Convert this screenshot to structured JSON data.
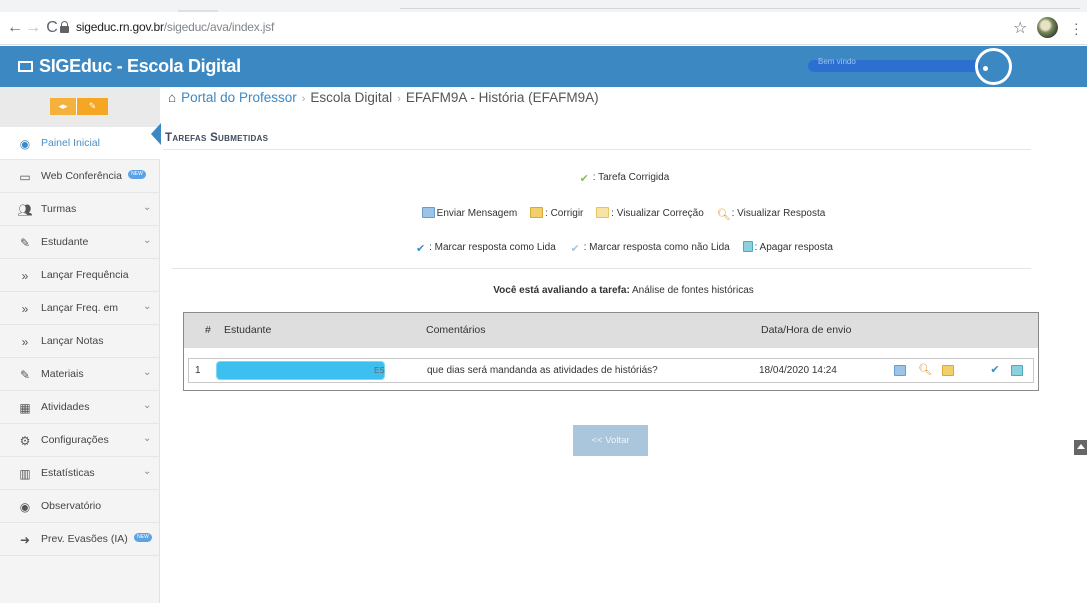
{
  "browser": {
    "url_domain": "sigeduc.rn.gov.br",
    "url_path": "/sigeduc/ava/index.jsf"
  },
  "header": {
    "brand": "SIGEduc - Escola Digital",
    "welcome": "Bem vindo",
    "color": "#3b88c3"
  },
  "sidebar": {
    "items": [
      {
        "label": "Painel Inicial",
        "icon": "dashboard-icon",
        "active": true
      },
      {
        "label": "Web Conferência",
        "icon": "monitor-icon",
        "badge": "NEW"
      },
      {
        "label": "Turmas",
        "icon": "group-icon",
        "chevron": true
      },
      {
        "label": "Estudante",
        "icon": "edit-icon",
        "chevron": true
      },
      {
        "label": "Lançar Frequência",
        "icon": "double-chevron-icon"
      },
      {
        "label": "Lançar Freq. em",
        "icon": "double-chevron-icon",
        "chevron": true
      },
      {
        "label": "Lançar Notas",
        "icon": "double-chevron-icon"
      },
      {
        "label": "Materiais",
        "icon": "edit-icon",
        "chevron": true
      },
      {
        "label": "Atividades",
        "icon": "calendar-icon",
        "chevron": true
      },
      {
        "label": "Configurações",
        "icon": "gears-icon",
        "chevron": true
      },
      {
        "label": "Estatísticas",
        "icon": "bar-chart-icon",
        "chevron": true
      },
      {
        "label": "Observatório",
        "icon": "eye-icon"
      },
      {
        "label": "Prev. Evasões (IA)",
        "icon": "sign-in-icon",
        "badge": "NEW"
      }
    ]
  },
  "breadcrumb": {
    "home": "Portal do Professor",
    "level2": "Escola Digital",
    "level3": "EFAFM9A - História (EFAFM9A)"
  },
  "page": {
    "title": "Tarefas Submetidas"
  },
  "legend": {
    "corrigida": ": Tarefa Corrigida",
    "enviar": "Enviar Mensagem",
    "corrigir": ": Corrigir",
    "visualizar_correcao": ": Visualizar Correção",
    "visualizar_resposta": ": Visualizar Resposta",
    "marcar_lida": ": Marcar resposta como Lida",
    "marcar_nao_lida": ": Marcar resposta como não Lida",
    "apagar": ": Apagar resposta"
  },
  "assessment": {
    "prefix": "Você está avaliando a tarefa:",
    "task": "Análise de fontes históricas"
  },
  "table": {
    "headers": {
      "num": "#",
      "student": "Estudante",
      "comments": "Comentários",
      "date": "Data/Hora de envio"
    },
    "rows": [
      {
        "num": "1",
        "student_suffix": "ES",
        "comment": "que dias será mandanda as atividades de históriás?",
        "date": "18/04/2020 14:24"
      }
    ]
  },
  "buttons": {
    "back": "<< Voltar"
  }
}
